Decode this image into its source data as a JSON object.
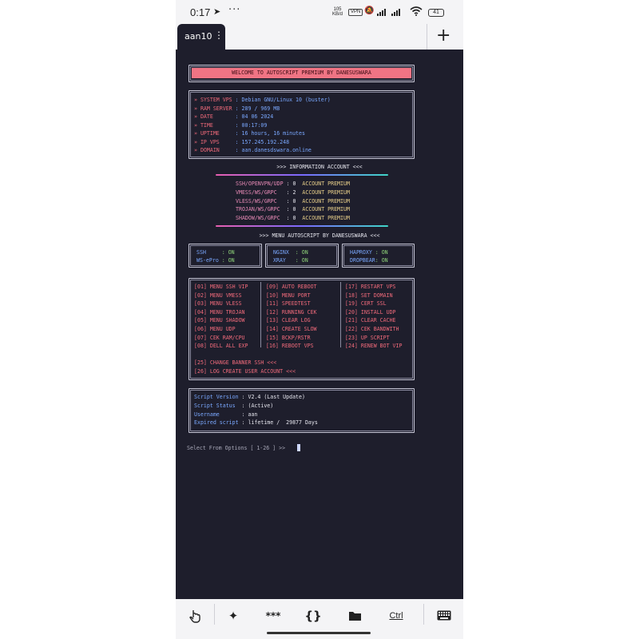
{
  "status_bar": {
    "time": "0:17",
    "nav_icon": "navigation-arrow-icon",
    "dots": "···",
    "net_speed_value": "105",
    "net_speed_unit": "KB/d",
    "vpn": "VPN",
    "battery": "41"
  },
  "tab_bar": {
    "session_label": "aan10",
    "session_menu": "⋮",
    "new_tab": "+"
  },
  "terminal": {
    "welcome": "WELCOME TO AUTOSCRIPT PREMIUM BY DANESUSWARA",
    "system_info": [
      {
        "key": "» SYSTEM VPS ",
        "value": ": Debian GNU/Linux 10 (buster)"
      },
      {
        "key": "» RAM SERVER ",
        "value": ": 289 / 969 MB"
      },
      {
        "key": "» DATE       ",
        "value": ": 04 06 2024"
      },
      {
        "key": "» TIME       ",
        "value": ": 00:17:09"
      },
      {
        "key": "» UPTIME     ",
        "value": ": 16 hours, 16 minutes"
      },
      {
        "key": "» IP VPS     ",
        "value": ": 157.245.192.248"
      },
      {
        "key": "» DOMAIN     ",
        "value": ": aan.danesdswara.online"
      }
    ],
    "info_account_title": ">>> INFORMATION ACCOUNT <<<",
    "accounts": [
      {
        "name": "SSH/OPENVPN/UDP",
        "count": "0",
        "label": "ACCOUNT PREMIUM"
      },
      {
        "name": "VMESS/WS/GRPC  ",
        "count": "2",
        "label": "ACCOUNT PREMIUM"
      },
      {
        "name": "VLESS/WS/GRPC  ",
        "count": "0",
        "label": "ACCOUNT PREMIUM"
      },
      {
        "name": "TROJAN/WS/GRPC ",
        "count": "0",
        "label": "ACCOUNT PREMIUM"
      },
      {
        "name": "SHADOW/WS/GRPC ",
        "count": "0",
        "label": "ACCOUNT PREMIUM"
      }
    ],
    "menu_title": ">>> MENU AUTOSCRIPT BY DANESUSWARA <<<",
    "services": {
      "col1": [
        {
          "name": "SSH     ",
          "state": ": ON"
        },
        {
          "name": "WS-ePro ",
          "state": ": ON"
        }
      ],
      "col2": [
        {
          "name": "NGINX  ",
          "state": ": ON"
        },
        {
          "name": "XRAY   ",
          "state": ": ON"
        }
      ],
      "col3": [
        {
          "name": "HAPROXY ",
          "state": ": ON"
        },
        {
          "name": "DROPBEAR",
          "state": ": ON"
        }
      ]
    },
    "menu_col1": [
      "[01] MENU SSH VIP",
      "[02] MENU VMESS",
      "[03] MENU VLESS",
      "[04] MENU TROJAN",
      "[05] MENU SHADOW",
      "[06] MENU UDP",
      "[07] CEK RAM/CPU",
      "[08] DELL ALL EXP"
    ],
    "menu_col2": [
      "[09] AUTO REBOOT",
      "[10] MENU PORT",
      "[11] SPEEDTEST",
      "[12] RUNNING CEK",
      "[13] CLEAR LOG",
      "[14] CREATE SLOW",
      "[15] BCKP/RSTR",
      "[16] REBOOT VPS"
    ],
    "menu_col3": [
      "[17] RESTART VPS",
      "[18] SET DOMAIN",
      "[19] CERT SSL",
      "[20] INSTALL UDP",
      "[21] CLEAR CACHE",
      "[22] CEK BANDWITH",
      "[23] UP SCRIPT",
      "[24] RENEW BOT VIP"
    ],
    "menu_extra": [
      "[25] CHANGE BANNER SSH <<<",
      "[26] LOG CREATE USER ACCOUNT <<<"
    ],
    "script_info": [
      {
        "key": "Script Version ",
        "value": ": V2.4 (Last Update)"
      },
      {
        "key": "Script Status  ",
        "value": ": (Active)"
      },
      {
        "key": "Username       ",
        "value": ": aan"
      },
      {
        "key": "Expired script ",
        "value": ": lifetime /  29877 Days"
      }
    ],
    "prompt": "Select From Options [ 1-26 ] >> "
  },
  "toolbar": {
    "touch": "touch-icon",
    "magic": "magic-wand-icon",
    "stars": "***",
    "braces": "{}",
    "folder": "folder-icon",
    "ctrl": "Ctrl",
    "keyboard": "keyboard-icon"
  },
  "colors": {
    "terminal_bg": "#1e1e2c",
    "banner": "#f07484",
    "key_red": "#f06a7a",
    "value_blue": "#7aa8ff"
  }
}
